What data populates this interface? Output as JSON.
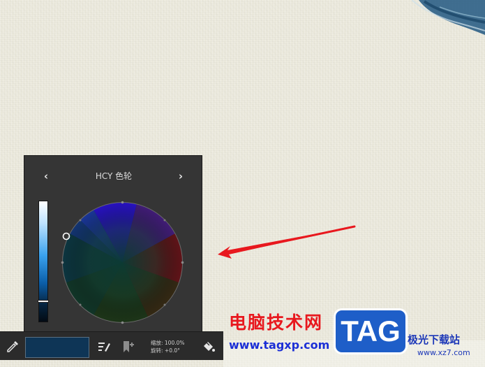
{
  "color_panel": {
    "title": "HCY 色轮",
    "prev_icon": "‹",
    "next_icon": "›",
    "luminance_level": 0.84
  },
  "toolbar": {
    "eyedropper_icon": "eyedropper-icon",
    "current_color": "#0e3556",
    "edit_brush_icon": "brush-edit-icon",
    "add_bookmark_icon": "bookmark-add-icon",
    "zoom_label": "缩放: 100.0%",
    "rotation_label": "旋转: +0.0°",
    "fill_icon": "paint-bucket-icon"
  },
  "watermark": {
    "title": "电脑技术网",
    "url": "www.tagxp.com",
    "logo": "TAG",
    "site_name": "极光下载站",
    "site_url": "www.xz7.com"
  },
  "colors": {
    "panel_bg": "#353535",
    "annotation_arrow": "#e8181e",
    "paint_stroke": "#2c5f86"
  }
}
